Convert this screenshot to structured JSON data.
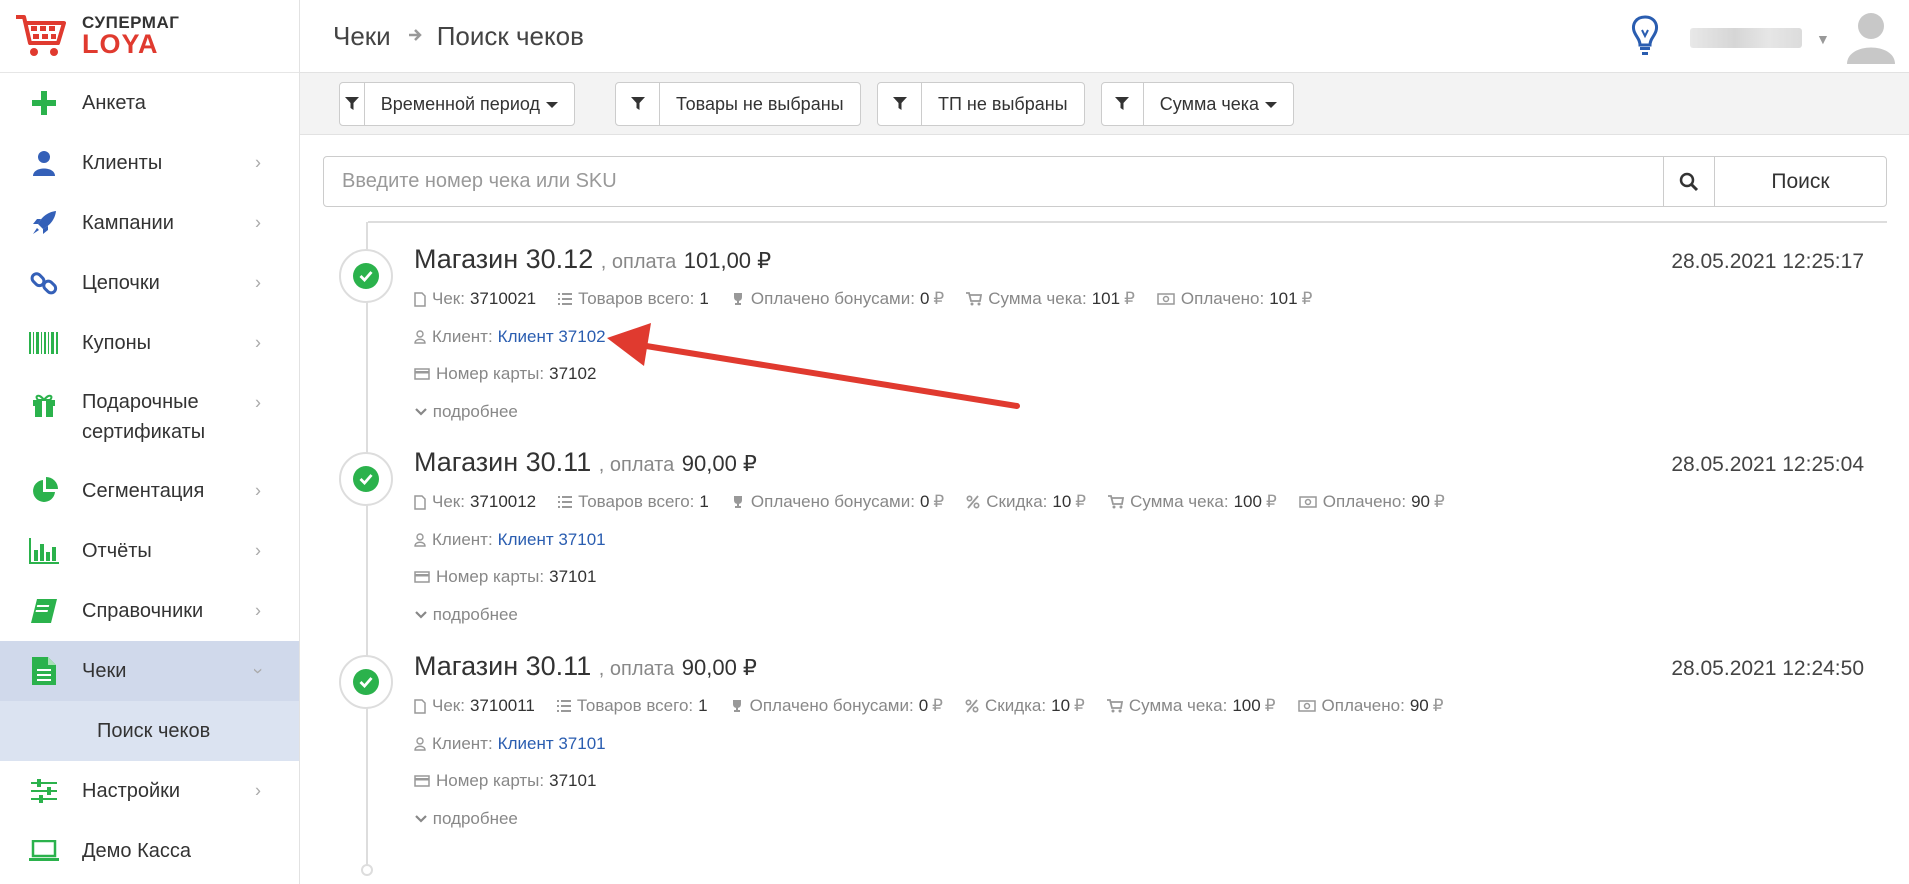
{
  "brand": {
    "line1": "СУПЕРМАГ",
    "line2": "LOYA"
  },
  "breadcrumb": {
    "parent": "Чеки",
    "current": "Поиск чеков"
  },
  "sidebar": {
    "items": [
      {
        "label": "Анкета",
        "icon": "plus-icon"
      },
      {
        "label": "Клиенты",
        "icon": "user-icon"
      },
      {
        "label": "Кампании",
        "icon": "rocket-icon"
      },
      {
        "label": "Цепочки",
        "icon": "link-icon"
      },
      {
        "label": "Купоны",
        "icon": "barcode-icon"
      },
      {
        "label": "Подарочные сертификаты",
        "icon": "gift-icon"
      },
      {
        "label": "Сегментация",
        "icon": "pie-icon"
      },
      {
        "label": "Отчёты",
        "icon": "bar-chart-icon"
      },
      {
        "label": "Справочники",
        "icon": "book-icon"
      },
      {
        "label": "Чеки",
        "icon": "document-icon"
      },
      {
        "label": "Настройки",
        "icon": "sliders-icon"
      },
      {
        "label": "Демо Касса",
        "icon": "laptop-icon"
      }
    ],
    "sub_item": "Поиск чеков"
  },
  "filters": [
    {
      "label": "Временной период",
      "dropdown": true
    },
    {
      "label": "Товары не выбраны",
      "dropdown": false
    },
    {
      "label": "ТП не выбраны",
      "dropdown": false
    },
    {
      "label": "Сумма чека",
      "dropdown": true
    }
  ],
  "search": {
    "placeholder": "Введите номер чека или SKU",
    "button": "Поиск"
  },
  "labels": {
    "pay": "оплата",
    "check": "Чек:",
    "items_total": "Товаров всего:",
    "bonus_paid": "Оплачено бонусами:",
    "discount": "Скидка:",
    "sum": "Сумма чека:",
    "paid": "Оплачено:",
    "client": "Клиент:",
    "card": "Номер карты:",
    "more": "подробнее",
    "currency": "₽"
  },
  "receipts": [
    {
      "store": "Магазин 30.12",
      "amount": "101,00 ₽",
      "date": "28.05.2021 12:25:17",
      "check": "3710021",
      "items": "1",
      "bonus": "0",
      "discount": null,
      "sum": "101",
      "paid": "101",
      "client": "Клиент 37102",
      "card": "37102"
    },
    {
      "store": "Магазин 30.11",
      "amount": "90,00 ₽",
      "date": "28.05.2021 12:25:04",
      "check": "3710012",
      "items": "1",
      "bonus": "0",
      "discount": "10",
      "sum": "100",
      "paid": "90",
      "client": "Клиент 37101",
      "card": "37101"
    },
    {
      "store": "Магазин 30.11",
      "amount": "90,00 ₽",
      "date": "28.05.2021 12:24:50",
      "check": "3710011",
      "items": "1",
      "bonus": "0",
      "discount": "10",
      "sum": "100",
      "paid": "90",
      "client": "Клиент 37101",
      "card": "37101"
    }
  ],
  "colors": {
    "accent_green": "#2bb24c",
    "link_blue": "#2a5db0",
    "active_bg": "#d0d9eb",
    "annotation_red": "#e03a2f"
  }
}
